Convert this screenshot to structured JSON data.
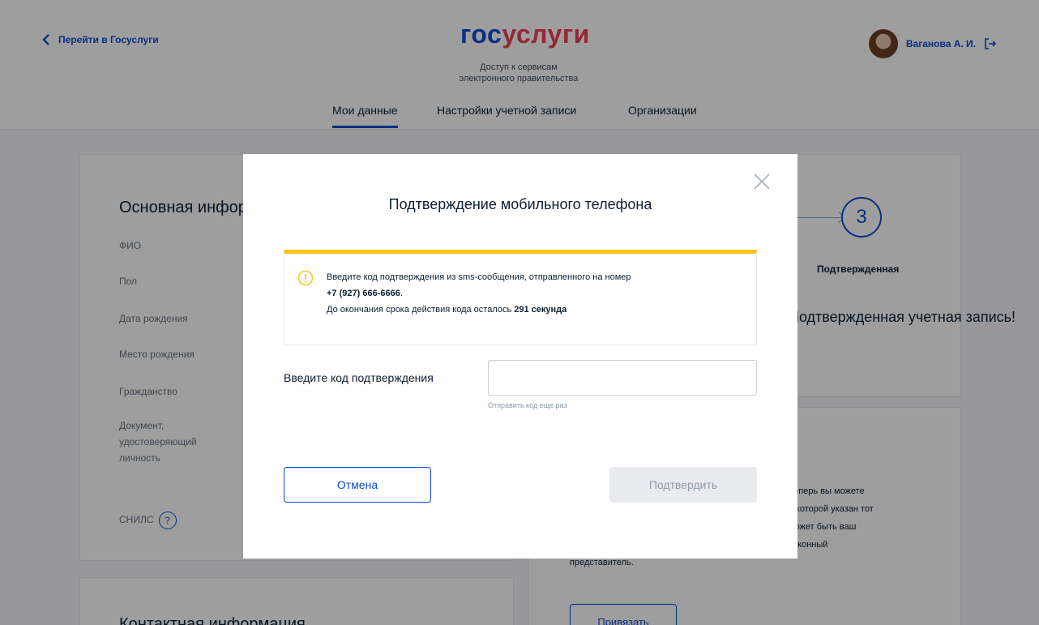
{
  "header": {
    "back_link": "Перейти в Госуслуги",
    "logo_part1": "гос",
    "logo_part2": "услуги",
    "tagline_line1": "Доступ к сервисам",
    "tagline_line2": "электронного правительства",
    "nav": [
      {
        "label": "Мои данные",
        "active": true
      },
      {
        "label": "Настройки учетной записи",
        "active": false
      },
      {
        "label": "Организации",
        "active": false
      }
    ],
    "user_name": "Ваганова А. И."
  },
  "main_card": {
    "title": "Основная информация",
    "fields": [
      "ФИО",
      "Пол",
      "Дата рождения",
      "Место рождения",
      "Гражданство",
      "Документ, удостоверяющий личность",
      "СНИЛС"
    ],
    "snils_help": "?"
  },
  "status_card": {
    "step_number": "3",
    "step_label": "Подтвержденная",
    "heading": "Подтвержденная учетная запись!"
  },
  "info_card": {
    "text_lines": [
      "Теперь вы можете",
      "в которой указан тот",
      "может быть ваш",
      "законный",
      "представитель."
    ],
    "bind_button": "Привязать"
  },
  "contacts_card": {
    "title": "Контактная информация"
  },
  "modal": {
    "title": "Подтверждение мобильного телефона",
    "alert": {
      "text_before_phone": "Введите код подтверждения из sms-сообщения, отправленного на номер",
      "phone": "+7 (927) 666-6666",
      "phone_suffix": ".",
      "timer_prefix": "До окончания срока действия кода осталось",
      "timer_value": "291 секунда"
    },
    "code_label": "Введите код подтверждения",
    "code_value": "",
    "resend_link": "Отправить код еще раз",
    "cancel_button": "Отмена",
    "confirm_button": "Подтвердить"
  },
  "colors": {
    "brand_blue": "#0d4cd3",
    "brand_red": "#ee3f58",
    "warning_yellow": "#fcc419",
    "overlay": "rgba(0,0,0,0.38)"
  },
  "icons": [
    "chevron-left-icon",
    "logout-icon",
    "close-icon",
    "warning-icon",
    "help-icon"
  ]
}
